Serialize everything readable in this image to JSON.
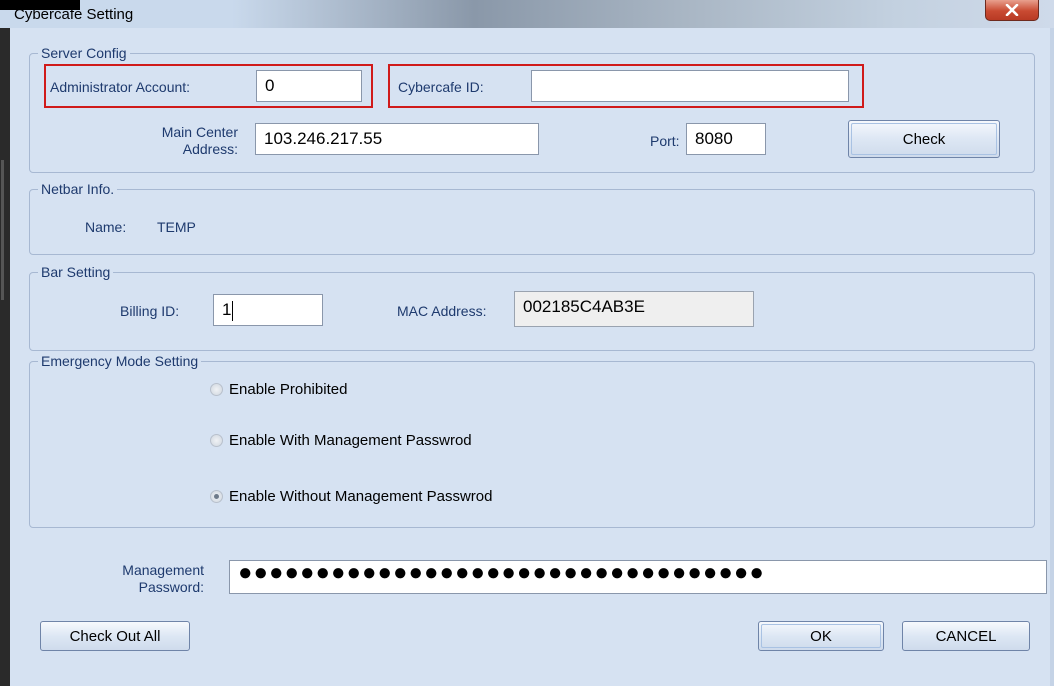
{
  "window": {
    "title": "Cybercafe Setting",
    "close_icon": "close-icon"
  },
  "server_config": {
    "legend": "Server Config",
    "admin_account_label": "Administrator Account:",
    "admin_account_value": "0",
    "cybercafe_id_label": "Cybercafe ID:",
    "cybercafe_id_value": "",
    "main_center_label_line1": "Main Center",
    "main_center_label_line2": "Address:",
    "main_center_value": "103.246.217.55",
    "port_label": "Port:",
    "port_value": "8080",
    "check_button": "Check"
  },
  "netbar_info": {
    "legend": "Netbar Info.",
    "name_label": "Name:",
    "name_value": "TEMP"
  },
  "bar_setting": {
    "legend": "Bar Setting",
    "billing_id_label": "Billing ID:",
    "billing_id_value": "1",
    "mac_label": "MAC Address:",
    "mac_value": "002185C4AB3E"
  },
  "emergency_mode": {
    "legend": "Emergency Mode Setting",
    "options": [
      {
        "label": "Enable Prohibited",
        "checked": false
      },
      {
        "label": "Enable With Management Passwrod",
        "checked": false
      },
      {
        "label": "Enable Without Management Passwrod",
        "checked": true
      }
    ]
  },
  "management_password": {
    "label_line1": "Management",
    "label_line2": "Password:",
    "value": "●●●●●●●●●●●●●●●●●●●●●●●●●●●●●●●●●●"
  },
  "footer": {
    "check_out_all": "Check Out All",
    "ok": "OK",
    "cancel": "CANCEL"
  },
  "colors": {
    "dialog_bg": "#d6e2f2",
    "label_text": "#1e3a6e",
    "highlight_border": "#d01a1a",
    "close_button": "#c94a32"
  }
}
